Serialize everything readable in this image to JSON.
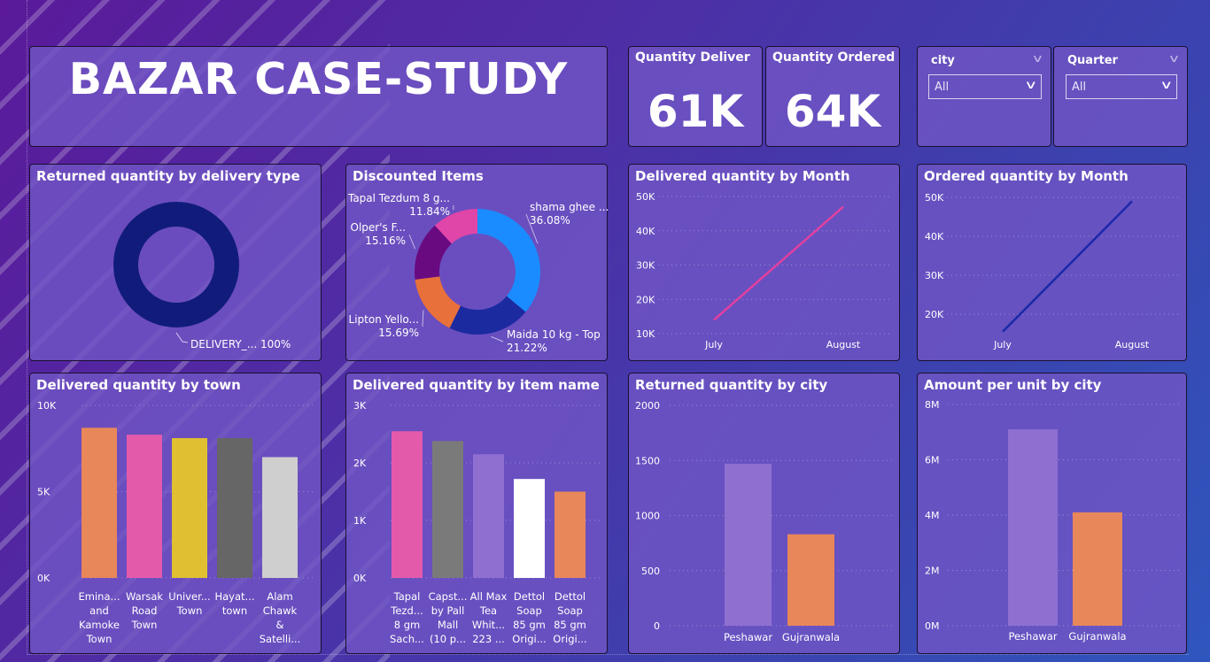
{
  "banner": {
    "title": "BAZAR CASE-STUDY"
  },
  "kpis": [
    {
      "label": "Quantity Deliver",
      "value": "61K"
    },
    {
      "label": "Quantity Ordered",
      "value": "64K"
    }
  ],
  "slicers": [
    {
      "label": "city",
      "value": "All"
    },
    {
      "label": "Quarter",
      "value": "All"
    }
  ],
  "colors": {
    "card": "#7055c4",
    "navy": "#111c7a",
    "pink": "#e45aab",
    "orange": "#e8875a",
    "purple": "#8f6fd0"
  },
  "chart_data": [
    {
      "id": "returned-by-delivery-type",
      "type": "pie",
      "title": "Returned quantity by delivery type",
      "slices": [
        {
          "label": "DELIVERY_...",
          "value": 100,
          "pct_label": "100%",
          "color": "#111c7a"
        }
      ]
    },
    {
      "id": "discounted-items",
      "type": "pie",
      "title": "Discounted Items",
      "slices": [
        {
          "label": "shama ghee ...",
          "value": 36.08,
          "pct_label": "36.08%",
          "color": "#1a8cff"
        },
        {
          "label": "Maida 10 kg - Top",
          "value": 21.22,
          "pct_label": "21.22%",
          "color": "#1c2aa0"
        },
        {
          "label": "Lipton Yello...",
          "value": 15.69,
          "pct_label": "15.69%",
          "color": "#e8703a"
        },
        {
          "label": "Olper's F...",
          "value": 15.16,
          "pct_label": "15.16%",
          "color": "#6a0a80"
        },
        {
          "label": "Tapal Tezdum 8 g...",
          "value": 11.84,
          "pct_label": "11.84%",
          "color": "#e045a8"
        }
      ]
    },
    {
      "id": "delivered-by-month",
      "type": "line",
      "title": "Delivered quantity by Month",
      "categories": [
        "July",
        "August"
      ],
      "series": [
        {
          "values": [
            14000,
            47000
          ],
          "color": "#e040a0"
        }
      ],
      "ylim": [
        10000,
        50000
      ],
      "yticks": [
        {
          "v": 10000,
          "label": "10K"
        },
        {
          "v": 20000,
          "label": "20K"
        },
        {
          "v": 30000,
          "label": "30K"
        },
        {
          "v": 40000,
          "label": "40K"
        },
        {
          "v": 50000,
          "label": "50K"
        }
      ]
    },
    {
      "id": "ordered-by-month",
      "type": "line",
      "title": "Ordered quantity by Month",
      "categories": [
        "July",
        "August"
      ],
      "series": [
        {
          "values": [
            15500,
            49000
          ],
          "color": "#1c28a8"
        }
      ],
      "ylim": [
        20000,
        50000
      ],
      "yticks": [
        {
          "v": 20000,
          "label": "20K"
        },
        {
          "v": 30000,
          "label": "30K"
        },
        {
          "v": 40000,
          "label": "40K"
        },
        {
          "v": 50000,
          "label": "50K"
        }
      ]
    },
    {
      "id": "delivered-by-town",
      "type": "bar",
      "title": "Delivered quantity by town",
      "categories": [
        [
          "Emina...",
          "and",
          "Kamoke",
          "Town"
        ],
        [
          "Warsak",
          "Road",
          "Town"
        ],
        [
          "Univer...",
          "Town"
        ],
        [
          "Hayat...",
          "town"
        ],
        [
          "Alam",
          "Chawk",
          "&",
          "Satelli..."
        ]
      ],
      "values": [
        8700,
        8300,
        8100,
        8100,
        7000
      ],
      "colors": [
        "#e8875a",
        "#e45aab",
        "#e0c030",
        "#666666",
        "#cfcfcf"
      ],
      "ylim": [
        0,
        10000
      ],
      "yticks": [
        {
          "v": 0,
          "label": "0K"
        },
        {
          "v": 5000,
          "label": "5K"
        },
        {
          "v": 10000,
          "label": "10K"
        }
      ]
    },
    {
      "id": "delivered-by-item",
      "type": "bar",
      "title": "Delivered quantity by item name",
      "categories": [
        [
          "Tapal",
          "Tezd...",
          "8 gm",
          "Sach..."
        ],
        [
          "Capst...",
          "by Pall",
          "Mall",
          "(10 p..."
        ],
        [
          "All Max",
          "Tea",
          "Whit...",
          "223 ..."
        ],
        [
          "Dettol",
          "Soap",
          "85 gm",
          "Origi..."
        ],
        [
          "Dettol",
          "Soap",
          "85 gm",
          "Origi..."
        ]
      ],
      "values": [
        2550,
        2380,
        2150,
        1720,
        1500
      ],
      "colors": [
        "#e45aab",
        "#7a7a7a",
        "#8f6fd0",
        "#ffffff",
        "#e8875a"
      ],
      "ylim": [
        0,
        3000
      ],
      "yticks": [
        {
          "v": 0,
          "label": "0K"
        },
        {
          "v": 1000,
          "label": "1K"
        },
        {
          "v": 2000,
          "label": "2K"
        },
        {
          "v": 3000,
          "label": "3K"
        }
      ]
    },
    {
      "id": "returned-by-city",
      "type": "bar",
      "title": "Returned quantity by city",
      "categories": [
        [
          "Peshawar"
        ],
        [
          "Gujranwala"
        ]
      ],
      "values": [
        1470,
        830
      ],
      "colors": [
        "#8f6fd0",
        "#e8875a"
      ],
      "ylim": [
        0,
        2000
      ],
      "yticks": [
        {
          "v": 0,
          "label": "0"
        },
        {
          "v": 500,
          "label": "500"
        },
        {
          "v": 1000,
          "label": "1000"
        },
        {
          "v": 1500,
          "label": "1500"
        },
        {
          "v": 2000,
          "label": "2000"
        }
      ]
    },
    {
      "id": "amount-per-unit-by-city",
      "type": "bar",
      "title": "Amount per unit by city",
      "categories": [
        [
          "Peshawar"
        ],
        [
          "Gujranwala"
        ]
      ],
      "values": [
        7100000,
        4100000
      ],
      "colors": [
        "#8f6fd0",
        "#e8875a"
      ],
      "ylim": [
        0,
        8000000
      ],
      "yticks": [
        {
          "v": 0,
          "label": "0M"
        },
        {
          "v": 2000000,
          "label": "2M"
        },
        {
          "v": 4000000,
          "label": "4M"
        },
        {
          "v": 6000000,
          "label": "6M"
        },
        {
          "v": 8000000,
          "label": "8M"
        }
      ]
    }
  ]
}
